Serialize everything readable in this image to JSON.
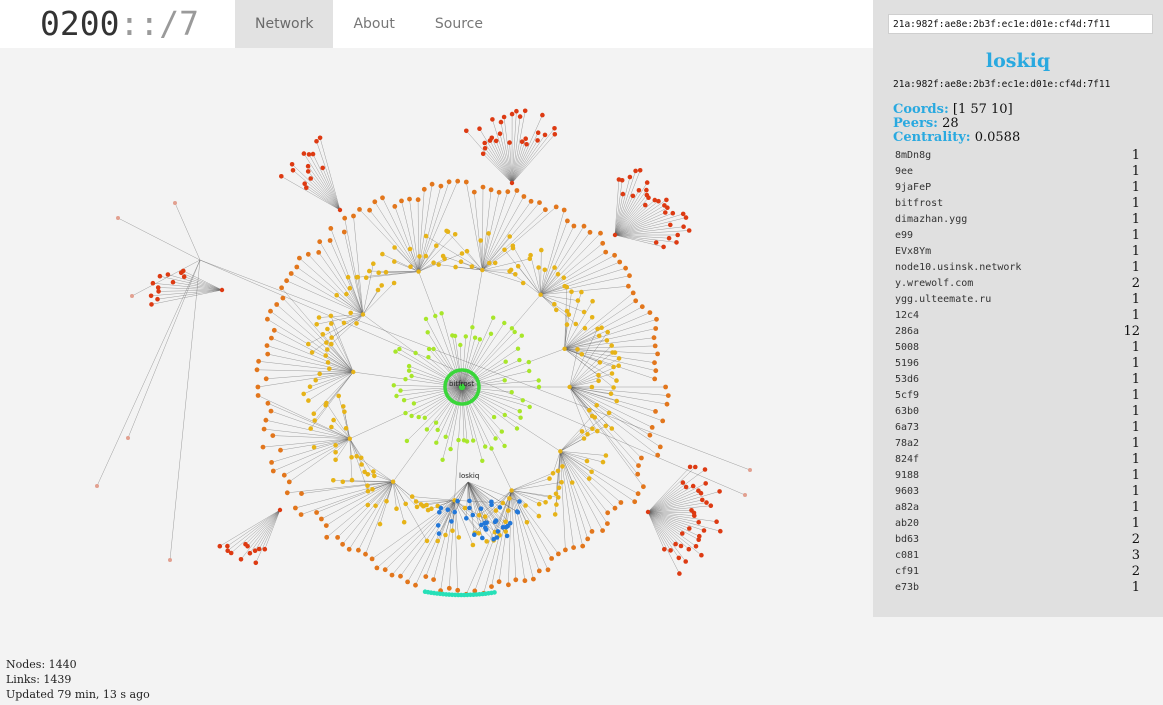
{
  "header": {
    "logo_main": "0200",
    "logo_dim": "::/7",
    "tabs": [
      {
        "label": "Network",
        "active": true
      },
      {
        "label": "About",
        "active": false
      },
      {
        "label": "Source",
        "active": false
      }
    ]
  },
  "search": {
    "value": "21a:982f:ae8e:2b3f:ec1e:d01e:cf4d:7f11"
  },
  "node": {
    "name": "loskiq",
    "address": "21a:982f:ae8e:2b3f:ec1e:d01e:cf4d:7f11",
    "coords_label": "Coords:",
    "coords": "[1 57 10]",
    "peers_label": "Peers:",
    "peers": "28",
    "centrality_label": "Centrality:",
    "centrality": "0.0588"
  },
  "peers": [
    {
      "name": "8mDn8g",
      "count": "1"
    },
    {
      "name": "9ee",
      "count": "1"
    },
    {
      "name": "9jaFeP",
      "count": "1"
    },
    {
      "name": "bitfrost",
      "count": "1"
    },
    {
      "name": "dimazhan.ygg",
      "count": "1"
    },
    {
      "name": "e99",
      "count": "1"
    },
    {
      "name": "EVx8Ym",
      "count": "1"
    },
    {
      "name": "node10.usinsk.network",
      "count": "1"
    },
    {
      "name": "y.wrewolf.com",
      "count": "2"
    },
    {
      "name": "ygg.ulteemate.ru",
      "count": "1"
    },
    {
      "name": "12c4",
      "count": "1"
    },
    {
      "name": "286a",
      "count": "12"
    },
    {
      "name": "5008",
      "count": "1"
    },
    {
      "name": "5196",
      "count": "1"
    },
    {
      "name": "53d6",
      "count": "1"
    },
    {
      "name": "5cf9",
      "count": "1"
    },
    {
      "name": "63b0",
      "count": "1"
    },
    {
      "name": "6a73",
      "count": "1"
    },
    {
      "name": "78a2",
      "count": "1"
    },
    {
      "name": "824f",
      "count": "1"
    },
    {
      "name": "9188",
      "count": "1"
    },
    {
      "name": "9603",
      "count": "1"
    },
    {
      "name": "a82a",
      "count": "1"
    },
    {
      "name": "ab20",
      "count": "1"
    },
    {
      "name": "bd63",
      "count": "2"
    },
    {
      "name": "c081",
      "count": "3"
    },
    {
      "name": "cf91",
      "count": "2"
    },
    {
      "name": "e73b",
      "count": "1"
    }
  ],
  "stats": {
    "nodes": "Nodes: 1440",
    "links": "Links: 1439",
    "updated": "Updated 79 min, 13 s ago"
  },
  "graph": {
    "root_label": "bitfrost",
    "selected_label": "loskiq",
    "colors": {
      "link": "#555555",
      "center": "#3ad63a",
      "lime": "#a8e62a",
      "yellow": "#e6b318",
      "orange": "#e2761c",
      "red": "#dd3a12",
      "blue": "#2277d8",
      "cyan": "#27e0b8",
      "pale": "#e2a090",
      "accent": "#29a9e0"
    }
  }
}
